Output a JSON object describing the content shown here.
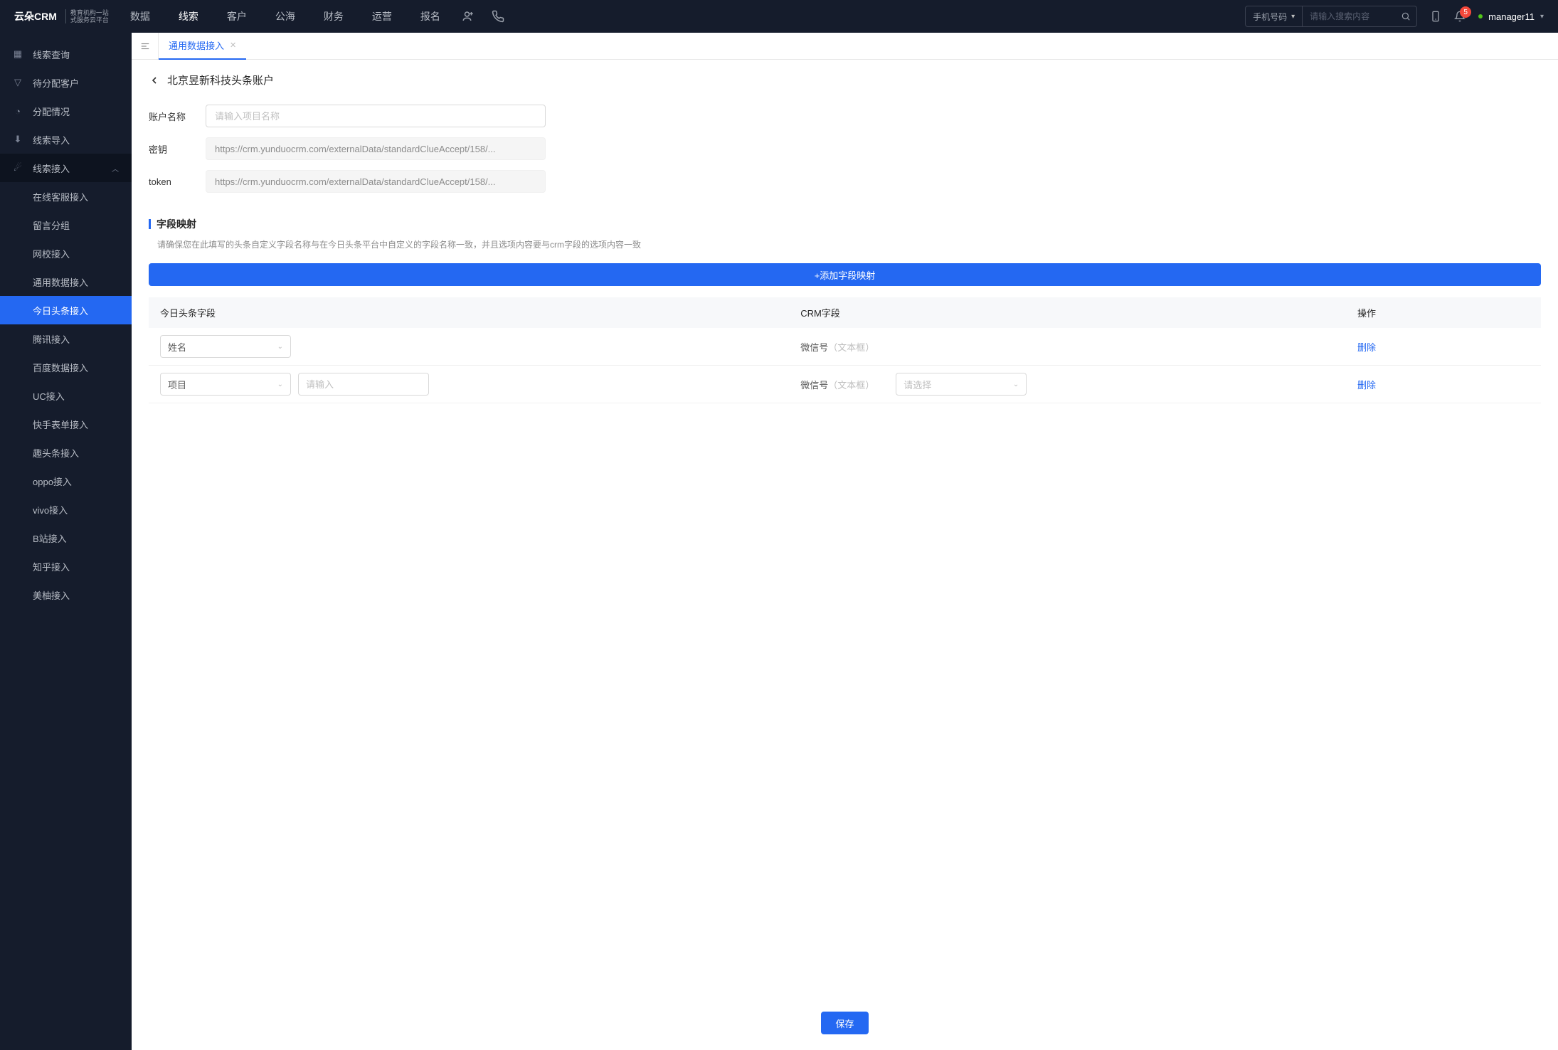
{
  "header": {
    "logo_brand": "云朵CRM",
    "logo_sub1": "教育机构一站",
    "logo_sub2": "式服务云平台",
    "nav": [
      "数据",
      "线索",
      "客户",
      "公海",
      "财务",
      "运营",
      "报名"
    ],
    "nav_active_index": 1,
    "search": {
      "type_label": "手机号码",
      "placeholder": "请输入搜索内容"
    },
    "notification_count": "5",
    "username": "manager11"
  },
  "sidebar": {
    "items": [
      {
        "label": "线索查询"
      },
      {
        "label": "待分配客户"
      },
      {
        "label": "分配情况"
      },
      {
        "label": "线索导入"
      }
    ],
    "parent_label": "线索接入",
    "sub_items": [
      "在线客服接入",
      "留言分组",
      "网校接入",
      "通用数据接入",
      "今日头条接入",
      "腾讯接入",
      "百度数据接入",
      "UC接入",
      "快手表单接入",
      "趣头条接入",
      "oppo接入",
      "vivo接入",
      "B站接入",
      "知乎接入",
      "美柚接入"
    ],
    "sub_active_index": 4
  },
  "tabs": {
    "active": "通用数据接入"
  },
  "page": {
    "title": "北京昱新科技头条账户",
    "form": {
      "name_label": "账户名称",
      "name_placeholder": "请输入项目名称",
      "key_label": "密钥",
      "key_value": "https://crm.yunduocrm.com/externalData/standardClueAccept/158/...",
      "token_label": "token",
      "token_value": "https://crm.yunduocrm.com/externalData/standardClueAccept/158/..."
    },
    "mapping": {
      "section_title": "字段映射",
      "section_desc": "请确保您在此填写的头条自定义字段名称与在今日头条平台中自定义的字段名称一致，并且选项内容要与crm字段的选项内容一致",
      "add_btn": "+添加字段映射",
      "columns": {
        "c1": "今日头条字段",
        "c2": "CRM字段",
        "c3": "操作"
      },
      "rows": [
        {
          "field_select": "姓名",
          "extra_input_placeholder": "",
          "crm_label": "微信号",
          "crm_hint": "（文本框）",
          "crm_select_placeholder": "",
          "action": "删除"
        },
        {
          "field_select": "项目",
          "extra_input_placeholder": "请输入",
          "crm_label": "微信号",
          "crm_hint": "（文本框）",
          "crm_select_placeholder": "请选择",
          "action": "删除"
        }
      ]
    },
    "save_btn": "保存"
  }
}
